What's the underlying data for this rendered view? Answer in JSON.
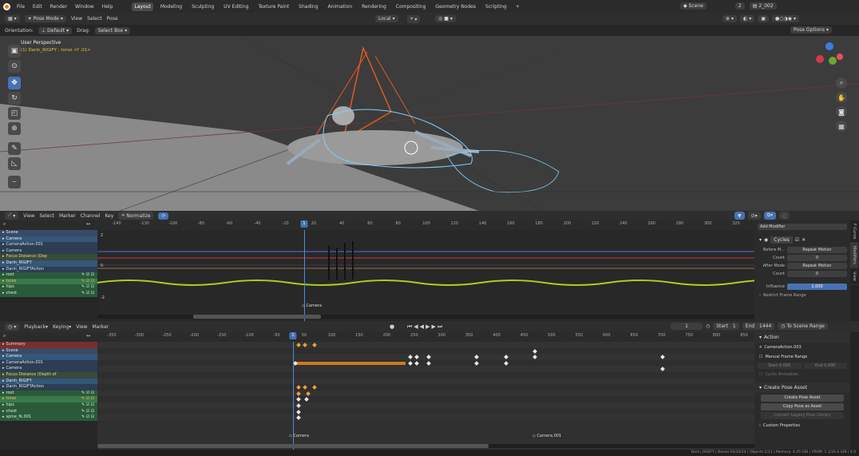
{
  "topbar": {
    "menus": [
      "File",
      "Edit",
      "Render",
      "Window",
      "Help"
    ],
    "workspaces": [
      "Layout",
      "Modeling",
      "Sculpting",
      "UV Editing",
      "Texture Paint",
      "Shading",
      "Animation",
      "Rendering",
      "Compositing",
      "Geometry Nodes",
      "Scripting"
    ],
    "active_workspace": "Layout",
    "add_tab": "+",
    "scene": "Scene",
    "frame": "2",
    "view_layer": "2_002"
  },
  "header3d": {
    "mode": "Pose Mode",
    "menus": [
      "View",
      "Select",
      "Pose"
    ],
    "transform": "Local"
  },
  "header3d2": {
    "orientation_label": "Orientation:",
    "orientation": "Default",
    "drag_label": "Drag:",
    "drag": "Select Box",
    "pose_options": "Pose Options"
  },
  "viewport": {
    "perspective": "User Perspective",
    "object_info": "(1) Darin_RIGIFY : torso <f .01>"
  },
  "dopesheet_driver": {
    "menus": [
      "View",
      "Select",
      "Marker",
      "Channel",
      "Key"
    ],
    "normalize": "Normalize",
    "ticks": [
      "-140",
      "-130",
      "-100",
      "-80",
      "-60",
      "-40",
      "-20",
      "20",
      "40",
      "60",
      "80",
      "100",
      "120",
      "140",
      "160",
      "180",
      "200",
      "220",
      "240",
      "260",
      "280",
      "300",
      "320"
    ],
    "current": "1",
    "y_labels": [
      "2",
      "0",
      "-2"
    ],
    "marker": "Camera",
    "channels": [
      {
        "label": "Scene",
        "kind": "scene"
      },
      {
        "label": "Camera",
        "kind": "obj"
      },
      {
        "label": "CameraAction.001",
        "kind": "act"
      },
      {
        "label": "Camera",
        "kind": "act"
      },
      {
        "label": "Focus Distance (Dep",
        "kind": "fc"
      },
      {
        "label": "Darin_RIGIFY",
        "kind": "obj"
      },
      {
        "label": "Darin_RIGIFYAction",
        "kind": "act"
      },
      {
        "label": "root",
        "kind": "grp"
      },
      {
        "label": "torso",
        "kind": "grp sel"
      },
      {
        "label": "hips",
        "kind": "grp"
      },
      {
        "label": "chest",
        "kind": "grp"
      }
    ],
    "side": {
      "add_modifier": "Add Modifier",
      "cycles": "Cycles",
      "fields": [
        {
          "label": "Before M...",
          "value": "Repeat Motion"
        },
        {
          "label": "Count",
          "value": "0"
        },
        {
          "label": "After Mode",
          "value": "Repeat Motion"
        },
        {
          "label": "Count",
          "value": "0"
        }
      ],
      "influence": "Influence",
      "influence_val": "1.000",
      "restrict": "Restrict Frame Range"
    },
    "tabs": [
      "F-Curve",
      "Modifiers",
      "View"
    ]
  },
  "dopesheet": {
    "playback": "Playback",
    "keying": "Keying",
    "menus": [
      "View",
      "Marker"
    ],
    "frame": "1",
    "start_label": "Start",
    "start": "1",
    "end_label": "End",
    "end": "1444",
    "to_scene": "To Scene Range",
    "ticks": [
      "-350",
      "-300",
      "-250",
      "-200",
      "-150",
      "-100",
      "-50",
      "50",
      "100",
      "150",
      "200",
      "250",
      "300",
      "350",
      "400",
      "450",
      "500",
      "550",
      "600",
      "650",
      "700",
      "750",
      "800",
      "850"
    ],
    "current": "1",
    "markers": [
      "Camera",
      "Camera.001"
    ],
    "channels": [
      {
        "label": "Summary",
        "kind": "sum"
      },
      {
        "label": "Scene",
        "kind": "scene"
      },
      {
        "label": "Camera",
        "kind": "obj"
      },
      {
        "label": "CameraAction.001",
        "kind": "act"
      },
      {
        "label": "Camera",
        "kind": "act"
      },
      {
        "label": "Focus Distance (Depth of",
        "kind": "fc"
      },
      {
        "label": "Darin_RIGIFY",
        "kind": "obj"
      },
      {
        "label": "Darin_RIGIFYAction",
        "kind": "act"
      },
      {
        "label": "root",
        "kind": "grp"
      },
      {
        "label": "torso",
        "kind": "grp sel"
      },
      {
        "label": "hips",
        "kind": "grp"
      },
      {
        "label": "chest",
        "kind": "grp"
      },
      {
        "label": "spine_fk.001",
        "kind": "grp"
      }
    ],
    "side": {
      "action_header": "Action",
      "action_name": "CameraAction.003",
      "manual_range": "Manual Frame Range",
      "start_lbl": "Start",
      "start_val": "0.000",
      "end_lbl": "End",
      "end_val": "0.000",
      "cyclic": "Cyclic Animation",
      "pose_header": "Create Pose Asset",
      "create_pose": "Create Pose Asset",
      "copy_pose": "Copy Pose as Asset",
      "convert": "Convert Legacy Pose Library",
      "custom": "Custom Properties"
    }
  },
  "status": "Darin_RIGIFY | Bones:16/34/24 | Objects:1/11 | Memory: 4.45 GiB | VRAM: 1.1/16.0 GiB | 4.0"
}
